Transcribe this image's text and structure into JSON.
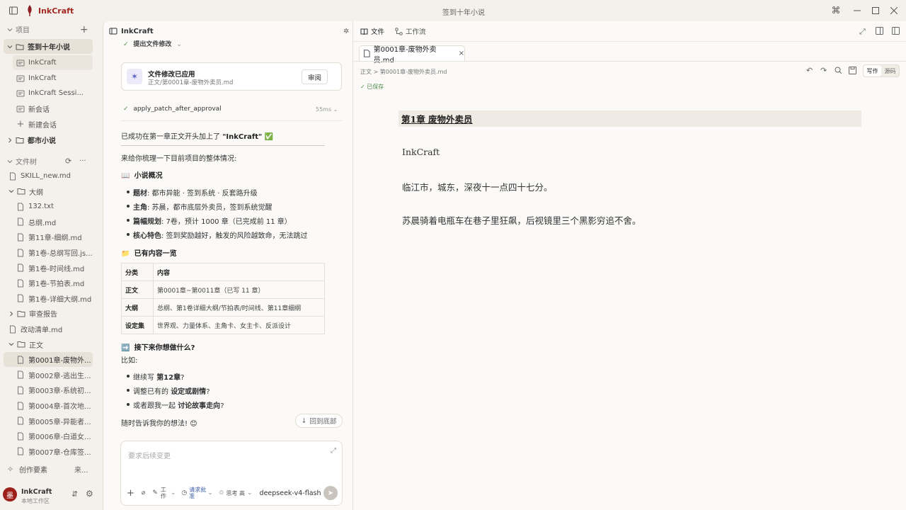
{
  "app": {
    "name": "InkCraft",
    "window_title": "签到十年小说"
  },
  "sidebar": {
    "projects_label": "项目",
    "project_items": [
      {
        "label": "签到十年小说"
      },
      {
        "label": "InkCraft"
      },
      {
        "label": "InkCraft"
      },
      {
        "label": "InkCraft Sessi..."
      },
      {
        "label": "新会话"
      },
      {
        "label": "新建会话"
      },
      {
        "label": "都市小说"
      }
    ],
    "filetree_label": "文件树",
    "files": [
      "SKILL_new.md",
      "大纲",
      "132.txt",
      "总纲.md",
      "第11章-细纲.md",
      "第1卷-总纲写回.js...",
      "第1卷-时间线.md",
      "第1卷-节拍表.md",
      "第1卷-详细大纲.md",
      "审查报告",
      "改动清单.md",
      "正文",
      "第0001章-废物外...",
      "第0002章-逃出生...",
      "第0003章-系统初...",
      "第0004章-首次地...",
      "第0005章-异能者...",
      "第0006章-白道女...",
      "第0007章-仓库签..."
    ],
    "elements_label": "创作要素",
    "elements_more": "来...",
    "workspace_name": "InkCraft",
    "workspace_sub": "本地工作区",
    "avatar_char": "墨"
  },
  "chat": {
    "title": "InkCraft",
    "top_status": "提出文件修改",
    "card_title": "文件修改已应用",
    "card_path": "正文/第0001章-废物外卖员.md",
    "card_button": "审阅",
    "tool_name": "apply_patch_after_approval",
    "tool_time": "55ms",
    "msg_success_prefix": "已成功在第一章正文开头加上了 ",
    "msg_success_bold": "\"InkCraft\"",
    "msg_success_emoji": "✅",
    "msg_intro": "来给你梳理一下目前项目的整体情况:",
    "overview_emoji": "📖",
    "overview_title": "小说概况",
    "overview": [
      {
        "k": "题材",
        "v": ": 都市异能 · 签到系统 · 反套路升级"
      },
      {
        "k": "主角",
        "v": ": 苏晨，都市底层外卖员，签到系统觉醒"
      },
      {
        "k": "篇幅规划",
        "v": ": 7卷，预计 1000 章（已完成前 11 章）"
      },
      {
        "k": "核心特色",
        "v": ": 签到奖励越好，触发的风险越致命，无法跳过"
      }
    ],
    "contents_emoji": "📁",
    "contents_title": "已有内容一览",
    "table_headers": [
      "分类",
      "内容"
    ],
    "table_rows": [
      {
        "k": "正文",
        "v": "第0001章~第0011章（已写 11 章）"
      },
      {
        "k": "大纲",
        "v": "总纲、第1卷详细大纲/节拍表/时间线、第11章细纲"
      },
      {
        "k": "设定集",
        "v": "世界观、力量体系、主角卡、女主卡、反派设计"
      }
    ],
    "next_emoji": "➡️",
    "next_title": "接下来你想做什么?",
    "next_intro": "比如:",
    "next_items": [
      {
        "pre": "继续写 ",
        "b": "第12章",
        "post": "?"
      },
      {
        "pre": "调整已有的 ",
        "b": "设定或剧情",
        "post": "?"
      },
      {
        "pre": "或者跟我一起 ",
        "b": "讨论故事走向",
        "post": "?"
      }
    ],
    "closing": "随时告诉我你的想法!",
    "closing_emoji": "😊",
    "jump_button": "回到底部",
    "input_placeholder": "要求后续变更",
    "tool_mode": "工作",
    "approval": "请求批准",
    "thinking": "思考 高",
    "model": "deepseek-v4-flash"
  },
  "editor": {
    "tab_file": "文件",
    "tab_flow": "工作流",
    "open_file": "第0001章-废物外卖员.md",
    "breadcrumb": "正文 > 第0001章-废物外卖员.md",
    "saved": "已保存",
    "mode_write": "写作",
    "mode_source": "源码",
    "heading": "第1章 废物外卖员",
    "paragraphs": [
      "InkCraft",
      "临江市，城东，深夜十一点四十七分。",
      "苏晨骑着电瓶车在巷子里狂飙，后视镜里三个黑影穷追不舍。"
    ]
  },
  "colors": {
    "brand": "#a3281f",
    "accent": "#5a5fc8",
    "saved": "#4f8a4a"
  }
}
